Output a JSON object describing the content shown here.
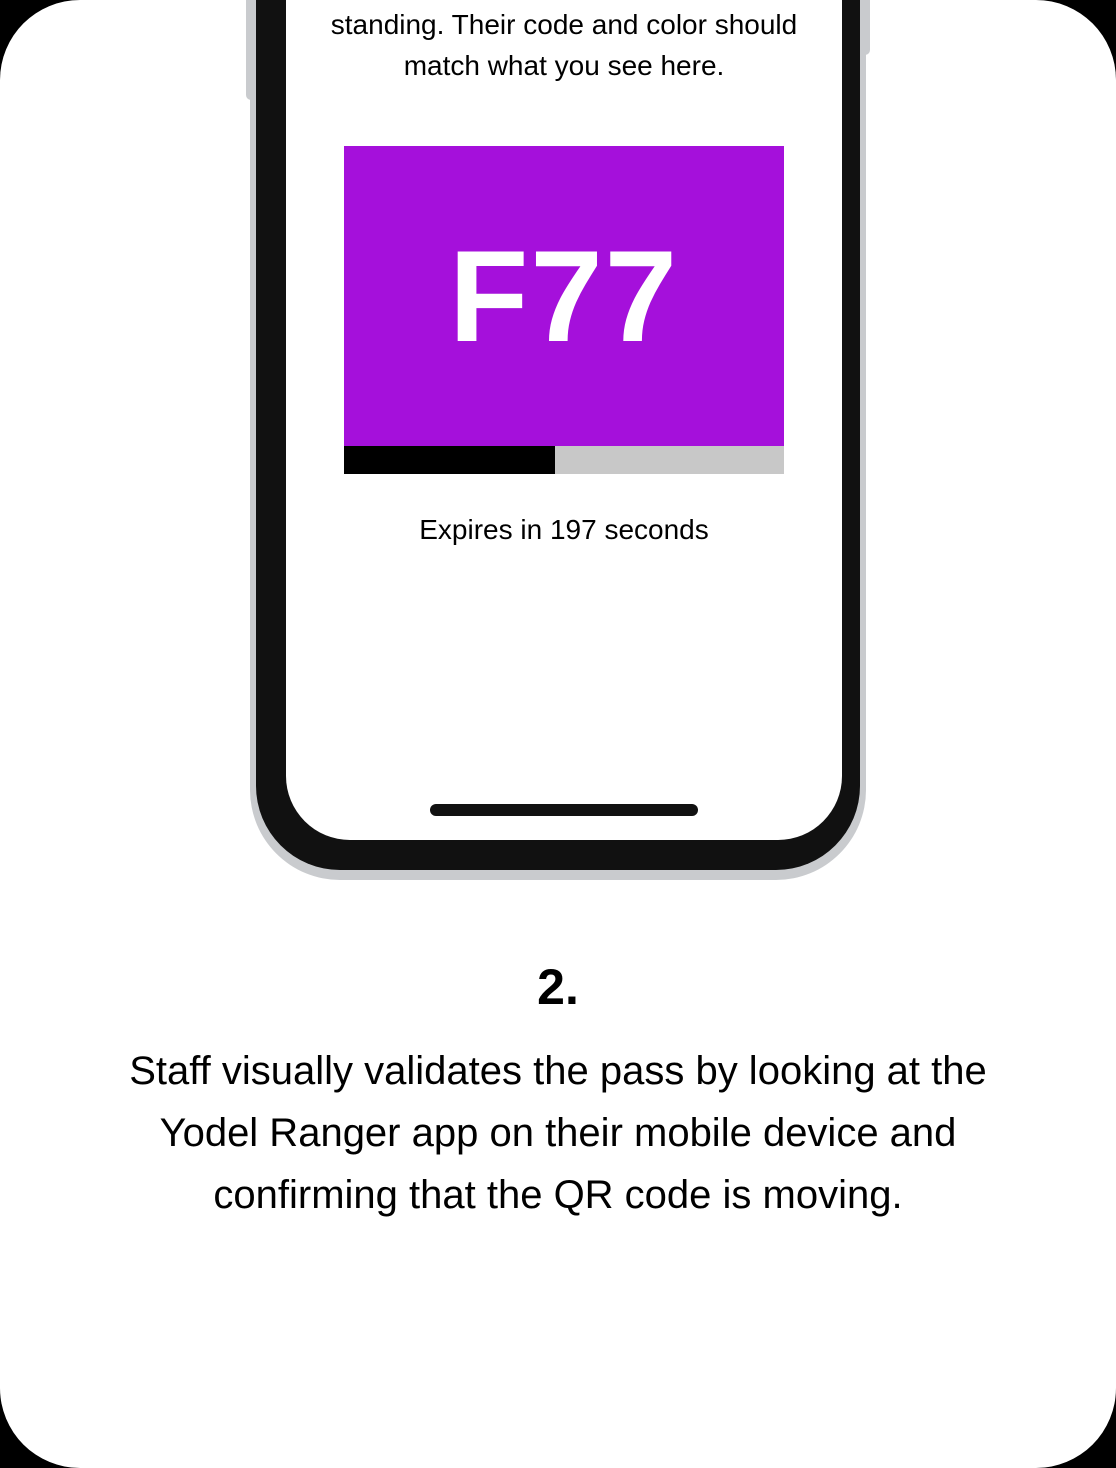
{
  "screen": {
    "instruction": "Use the visual validator to verify passes that are currently in good standing. Their code and color should match what you see here.",
    "code": "F77",
    "code_bg_color": "#a510db",
    "expires_text": "Expires in 197 seconds",
    "progress_percent": 48
  },
  "step": {
    "number": "2.",
    "description": "Staff visually validates the pass by looking at the Yodel Ranger app on their mobile device and confirming that the QR code is moving."
  }
}
